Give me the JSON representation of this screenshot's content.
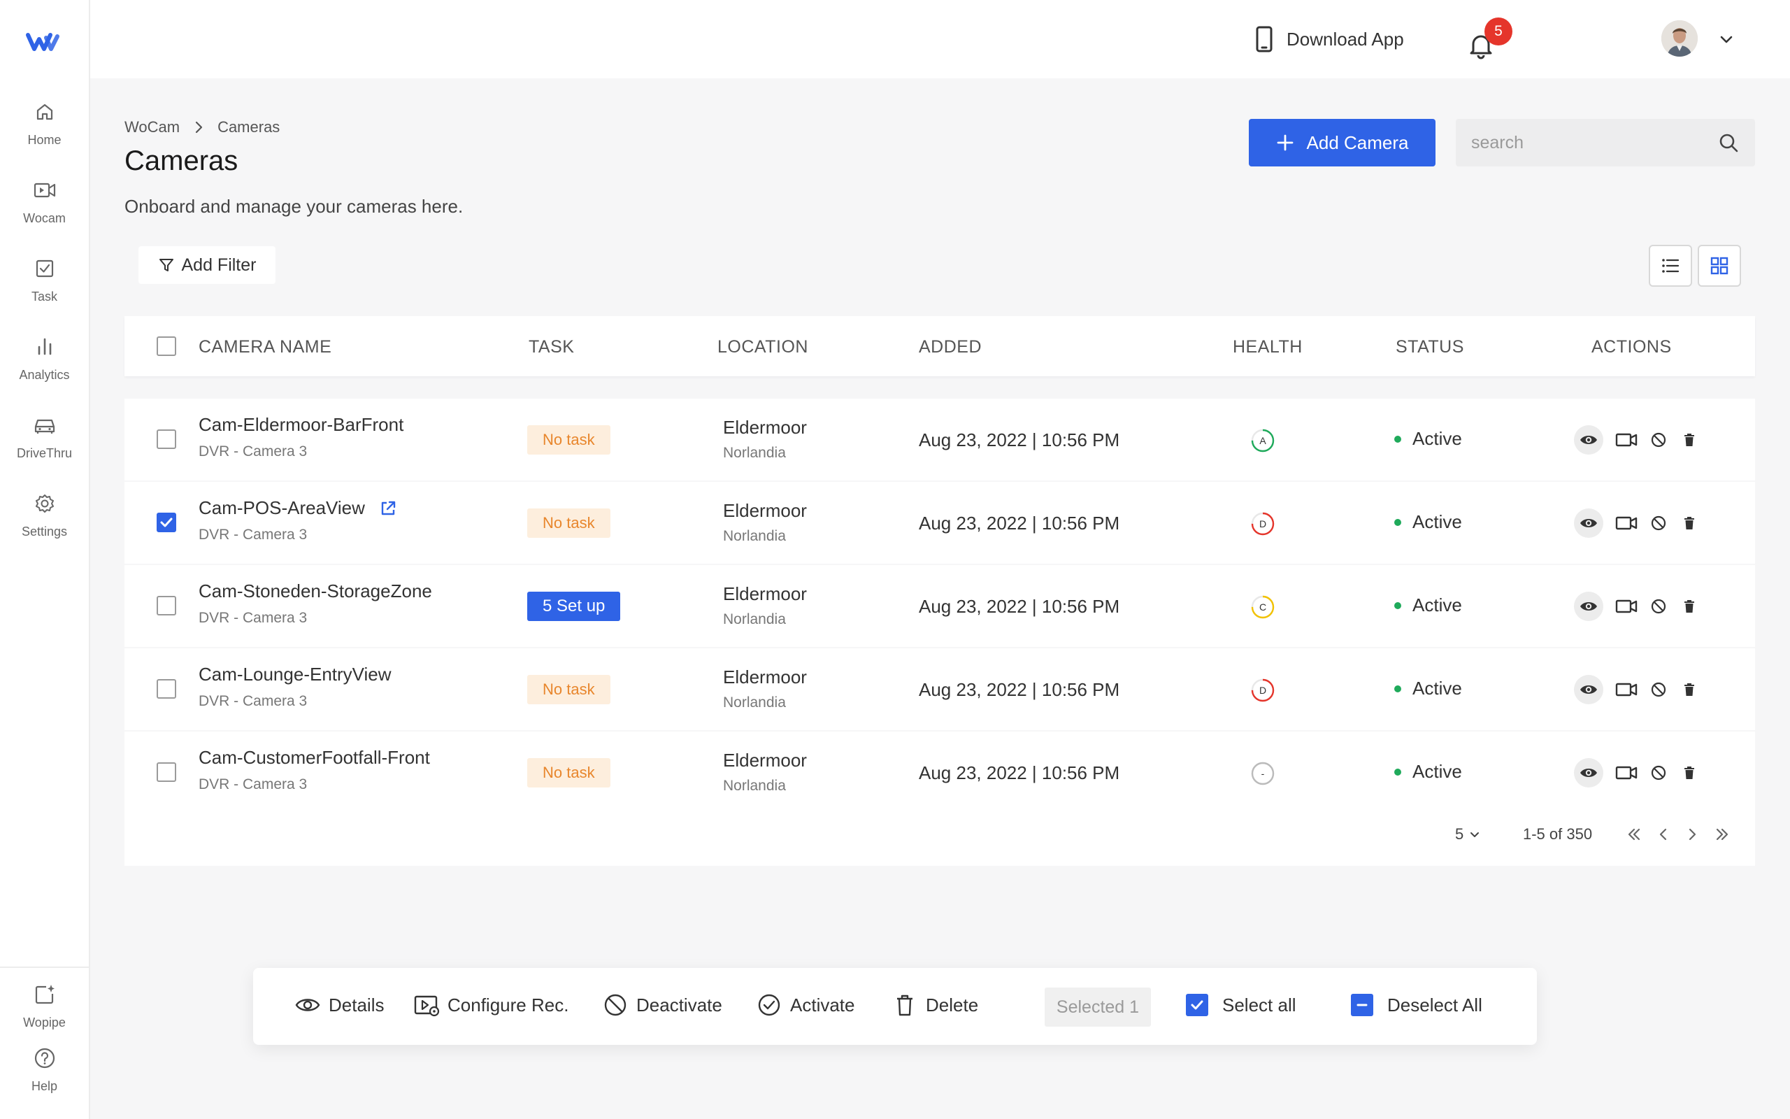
{
  "sidebar": {
    "items": [
      {
        "label": "Home"
      },
      {
        "label": "Wocam"
      },
      {
        "label": "Task"
      },
      {
        "label": "Analytics"
      },
      {
        "label": "DriveThru"
      },
      {
        "label": "Settings"
      }
    ],
    "bottom_items": [
      {
        "label": "Wopipe"
      },
      {
        "label": "Help"
      }
    ]
  },
  "topbar": {
    "download_label": "Download App",
    "notification_count": "5"
  },
  "breadcrumb": [
    "WoCam",
    "Cameras"
  ],
  "page": {
    "title": "Cameras",
    "subtitle": "Onboard and manage your cameras here."
  },
  "toolbar": {
    "add_camera_label": "Add Camera",
    "search_placeholder": "search",
    "add_filter_label": "Add Filter"
  },
  "table": {
    "columns": [
      "CAMERA NAME",
      "TASK",
      "LOCATION",
      "ADDED",
      "HEALTH",
      "STATUS",
      "ACTIONS"
    ],
    "rows": [
      {
        "name": "Cam-Eldermoor-BarFront",
        "sub": "DVR - Camera 3",
        "task": "No task",
        "task_type": "none",
        "location": "Eldermoor",
        "region": "Norlandia",
        "added": "Aug 23, 2022 | 10:56 PM",
        "health": "A",
        "health_color": "#1faa5b",
        "health_fraction": 0.75,
        "status": "Active",
        "checked": false
      },
      {
        "name": "Cam-POS-AreaView",
        "sub": "DVR - Camera 3",
        "task": "No task",
        "task_type": "none",
        "location": "Eldermoor",
        "region": "Norlandia",
        "added": "Aug 23, 2022 | 10:56 PM",
        "health": "D",
        "health_color": "#e5352b",
        "health_fraction": 0.75,
        "status": "Active",
        "checked": true
      },
      {
        "name": "Cam-Stoneden-StorageZone",
        "sub": "DVR - Camera 3",
        "task": "5 Set up",
        "task_type": "setup",
        "location": "Eldermoor",
        "region": "Norlandia",
        "added": "Aug 23, 2022 | 10:56 PM",
        "health": "C",
        "health_color": "#f2c200",
        "health_fraction": 0.75,
        "status": "Active",
        "checked": false
      },
      {
        "name": "Cam-Lounge-EntryView",
        "sub": "DVR - Camera 3",
        "task": "No task",
        "task_type": "none",
        "location": "Eldermoor",
        "region": "Norlandia",
        "added": "Aug 23, 2022 | 10:56 PM",
        "health": "D",
        "health_color": "#e5352b",
        "health_fraction": 0.75,
        "status": "Active",
        "checked": false
      },
      {
        "name": "Cam-CustomerFootfall-Front",
        "sub": "DVR - Camera 3",
        "task": "No task",
        "task_type": "none",
        "location": "Eldermoor",
        "region": "Norlandia",
        "added": "Aug 23, 2022 | 10:56 PM",
        "health": "-",
        "health_color": "#bbbbbb",
        "health_fraction": 1.0,
        "status": "Active",
        "checked": false
      }
    ]
  },
  "pagination": {
    "page_size": "5",
    "range": "1-5 of 350"
  },
  "bulk": {
    "details": "Details",
    "configure": "Configure Rec.",
    "deactivate": "Deactivate",
    "activate": "Activate",
    "delete": "Delete",
    "selected": "Selected 1",
    "select_all": "Select all",
    "deselect_all": "Deselect All"
  },
  "colors": {
    "accent": "#2f63e6",
    "status_active": "#1faa5b",
    "task_none_bg": "#fdeedd",
    "task_none_text": "#e8862c",
    "badge": "#e5352b"
  }
}
